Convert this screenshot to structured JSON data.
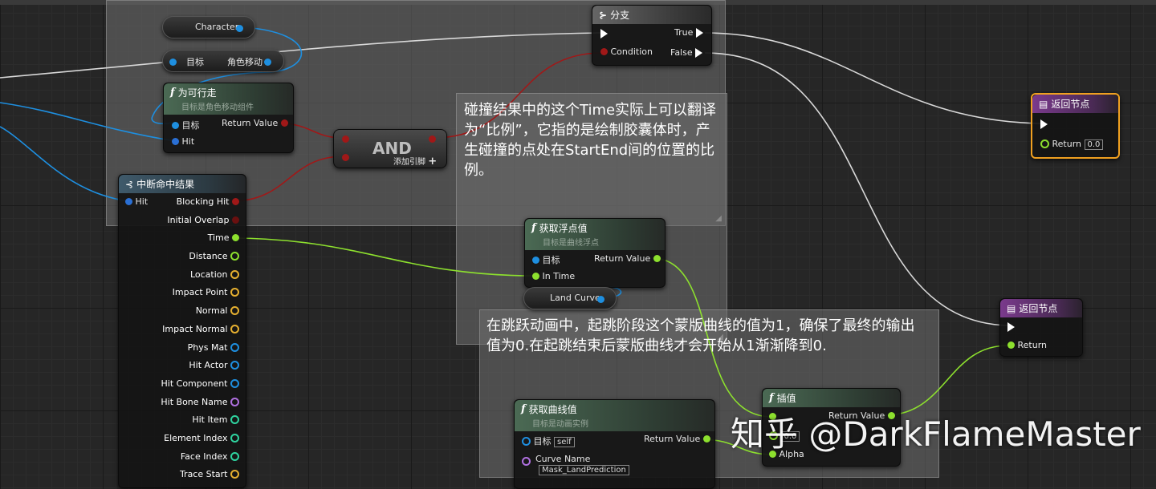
{
  "colors": {
    "exec": "#ffffff",
    "bool": "#8a1010",
    "object": "#1e8fe0",
    "float": "#8de02e",
    "vector": "#e6b030",
    "struct": "#2a6fd4",
    "name": "#b070e0",
    "int": "#2fd4a0",
    "return_outline": "#f0a020"
  },
  "nodes": {
    "character": {
      "label": "Character"
    },
    "movement": {
      "target_label": "目标",
      "label": "角色移动"
    },
    "walkable": {
      "title": "为可行走",
      "subtitle": "目标是角色移动组件",
      "target_label": "目标",
      "return_label": "Return Value",
      "hit_label": "Hit"
    },
    "and": {
      "title": "AND",
      "add_pin": "添加引脚"
    },
    "branch": {
      "title": "分支",
      "true_label": "True",
      "false_label": "False",
      "condition_label": "Condition"
    },
    "return_top": {
      "title": "返回节点",
      "return_label": "Return",
      "return_value": "0.0"
    },
    "break_hit": {
      "title": "中断命中结果",
      "hit_label": "Hit",
      "outputs": [
        {
          "label": "Blocking Hit"
        },
        {
          "label": "Initial Overlap"
        },
        {
          "label": "Time"
        },
        {
          "label": "Distance"
        },
        {
          "label": "Location"
        },
        {
          "label": "Impact Point"
        },
        {
          "label": "Normal"
        },
        {
          "label": "Impact Normal"
        },
        {
          "label": "Phys Mat"
        },
        {
          "label": "Hit Actor"
        },
        {
          "label": "Hit Component"
        },
        {
          "label": "Hit Bone Name"
        },
        {
          "label": "Hit Item"
        },
        {
          "label": "Element Index"
        },
        {
          "label": "Face Index"
        },
        {
          "label": "Trace Start"
        }
      ]
    },
    "get_float": {
      "title": "获取浮点值",
      "subtitle": "目标是曲线浮点",
      "target_label": "目标",
      "return_label": "Return Value",
      "in_time_label": "In Time"
    },
    "land_curve": {
      "label": "Land Curve"
    },
    "return_bottom": {
      "title": "返回节点",
      "return_label": "Return"
    },
    "get_curve": {
      "title": "获取曲线值",
      "subtitle": "目标是动画实例",
      "target_label": "目标",
      "target_value": "self",
      "return_label": "Return Value",
      "curve_name_label": "Curve Name",
      "curve_name_value": "Mask_LandPrediction"
    },
    "lerp": {
      "title": "插值",
      "return_label": "Return Value",
      "a_value": "0.0",
      "alpha_label": "Alpha"
    }
  },
  "comments": {
    "note1": "碰撞结果中的这个Time实际上可以翻译为“比例”，它指的是绘制胶囊体时，产生碰撞的点处在StartEnd间的位置的比例。",
    "note2": "在跳跃动画中，起跳阶段这个蒙版曲线的值为1，确保了最终的输出值为0.在起跳结束后蒙版曲线才会开始从1渐渐降到0."
  },
  "watermark": "知乎 @DarkFlameMaster"
}
